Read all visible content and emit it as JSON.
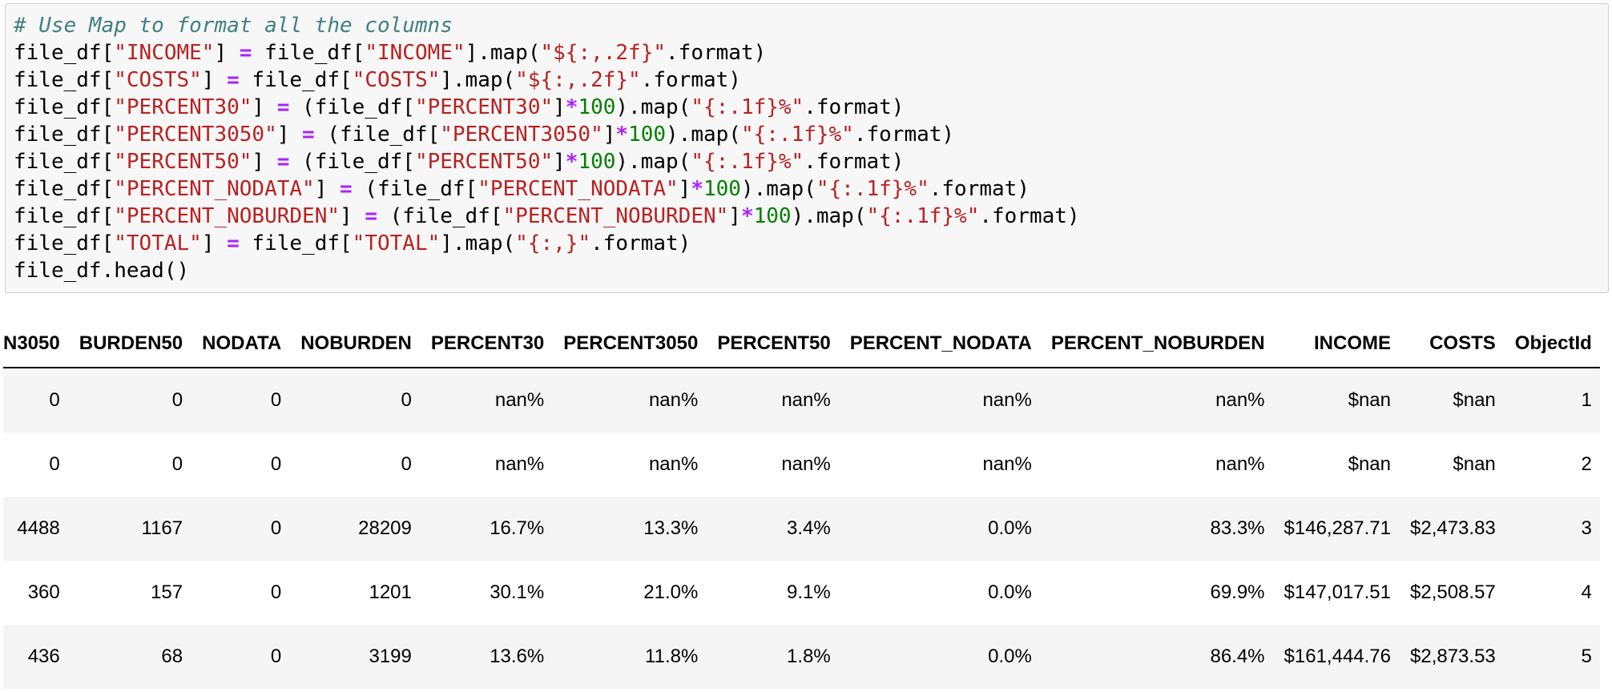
{
  "code": {
    "lines": [
      [
        {
          "t": "# Use Map to format all the columns",
          "c": "cm"
        }
      ],
      [
        {
          "t": "file_df["
        },
        {
          "t": "\"INCOME\"",
          "c": "st"
        },
        {
          "t": "] "
        },
        {
          "t": "=",
          "c": "op"
        },
        {
          "t": " file_df["
        },
        {
          "t": "\"INCOME\"",
          "c": "st"
        },
        {
          "t": "].map("
        },
        {
          "t": "\"${:,.2f}\"",
          "c": "st"
        },
        {
          "t": ".format)"
        }
      ],
      [
        {
          "t": "file_df["
        },
        {
          "t": "\"COSTS\"",
          "c": "st"
        },
        {
          "t": "] "
        },
        {
          "t": "=",
          "c": "op"
        },
        {
          "t": " file_df["
        },
        {
          "t": "\"COSTS\"",
          "c": "st"
        },
        {
          "t": "].map("
        },
        {
          "t": "\"${:,.2f}\"",
          "c": "st"
        },
        {
          "t": ".format)"
        }
      ],
      [
        {
          "t": "file_df["
        },
        {
          "t": "\"PERCENT30\"",
          "c": "st"
        },
        {
          "t": "] "
        },
        {
          "t": "=",
          "c": "op"
        },
        {
          "t": " (file_df["
        },
        {
          "t": "\"PERCENT30\"",
          "c": "st"
        },
        {
          "t": "]"
        },
        {
          "t": "*",
          "c": "op"
        },
        {
          "t": "100",
          "c": "nm"
        },
        {
          "t": ").map("
        },
        {
          "t": "\"{:.1f}%\"",
          "c": "st"
        },
        {
          "t": ".format)"
        }
      ],
      [
        {
          "t": "file_df["
        },
        {
          "t": "\"PERCENT3050\"",
          "c": "st"
        },
        {
          "t": "] "
        },
        {
          "t": "=",
          "c": "op"
        },
        {
          "t": " (file_df["
        },
        {
          "t": "\"PERCENT3050\"",
          "c": "st"
        },
        {
          "t": "]"
        },
        {
          "t": "*",
          "c": "op"
        },
        {
          "t": "100",
          "c": "nm"
        },
        {
          "t": ").map("
        },
        {
          "t": "\"{:.1f}%\"",
          "c": "st"
        },
        {
          "t": ".format)"
        }
      ],
      [
        {
          "t": "file_df["
        },
        {
          "t": "\"PERCENT50\"",
          "c": "st"
        },
        {
          "t": "] "
        },
        {
          "t": "=",
          "c": "op"
        },
        {
          "t": " (file_df["
        },
        {
          "t": "\"PERCENT50\"",
          "c": "st"
        },
        {
          "t": "]"
        },
        {
          "t": "*",
          "c": "op"
        },
        {
          "t": "100",
          "c": "nm"
        },
        {
          "t": ").map("
        },
        {
          "t": "\"{:.1f}%\"",
          "c": "st"
        },
        {
          "t": ".format)"
        }
      ],
      [
        {
          "t": "file_df["
        },
        {
          "t": "\"PERCENT_NODATA\"",
          "c": "st"
        },
        {
          "t": "] "
        },
        {
          "t": "=",
          "c": "op"
        },
        {
          "t": " (file_df["
        },
        {
          "t": "\"PERCENT_NODATA\"",
          "c": "st"
        },
        {
          "t": "]"
        },
        {
          "t": "*",
          "c": "op"
        },
        {
          "t": "100",
          "c": "nm"
        },
        {
          "t": ").map("
        },
        {
          "t": "\"{:.1f}%\"",
          "c": "st"
        },
        {
          "t": ".format)"
        }
      ],
      [
        {
          "t": "file_df["
        },
        {
          "t": "\"PERCENT_NOBURDEN\"",
          "c": "st"
        },
        {
          "t": "] "
        },
        {
          "t": "=",
          "c": "op"
        },
        {
          "t": " (file_df["
        },
        {
          "t": "\"PERCENT_NOBURDEN\"",
          "c": "st"
        },
        {
          "t": "]"
        },
        {
          "t": "*",
          "c": "op"
        },
        {
          "t": "100",
          "c": "nm"
        },
        {
          "t": ").map("
        },
        {
          "t": "\"{:.1f}%\"",
          "c": "st"
        },
        {
          "t": ".format)"
        }
      ],
      [
        {
          "t": "file_df["
        },
        {
          "t": "\"TOTAL\"",
          "c": "st"
        },
        {
          "t": "] "
        },
        {
          "t": "=",
          "c": "op"
        },
        {
          "t": " file_df["
        },
        {
          "t": "\"TOTAL\"",
          "c": "st"
        },
        {
          "t": "].map("
        },
        {
          "t": "\"{:,}\"",
          "c": "st"
        },
        {
          "t": ".format)"
        }
      ],
      [
        {
          "t": "file_df.head()"
        }
      ]
    ]
  },
  "output_table": {
    "headers": [
      "N3050",
      "BURDEN50",
      "NODATA",
      "NOBURDEN",
      "PERCENT30",
      "PERCENT3050",
      "PERCENT50",
      "PERCENT_NODATA",
      "PERCENT_NOBURDEN",
      "INCOME",
      "COSTS",
      "ObjectId"
    ],
    "rows": [
      [
        "0",
        "0",
        "0",
        "0",
        "nan%",
        "nan%",
        "nan%",
        "nan%",
        "nan%",
        "$nan",
        "$nan",
        "1"
      ],
      [
        "0",
        "0",
        "0",
        "0",
        "nan%",
        "nan%",
        "nan%",
        "nan%",
        "nan%",
        "$nan",
        "$nan",
        "2"
      ],
      [
        "4488",
        "1167",
        "0",
        "28209",
        "16.7%",
        "13.3%",
        "3.4%",
        "0.0%",
        "83.3%",
        "$146,287.71",
        "$2,473.83",
        "3"
      ],
      [
        "360",
        "157",
        "0",
        "1201",
        "30.1%",
        "21.0%",
        "9.1%",
        "0.0%",
        "69.9%",
        "$147,017.51",
        "$2,508.57",
        "4"
      ],
      [
        "436",
        "68",
        "0",
        "3199",
        "13.6%",
        "11.8%",
        "1.8%",
        "0.0%",
        "86.4%",
        "$161,444.76",
        "$2,873.53",
        "5"
      ]
    ]
  }
}
